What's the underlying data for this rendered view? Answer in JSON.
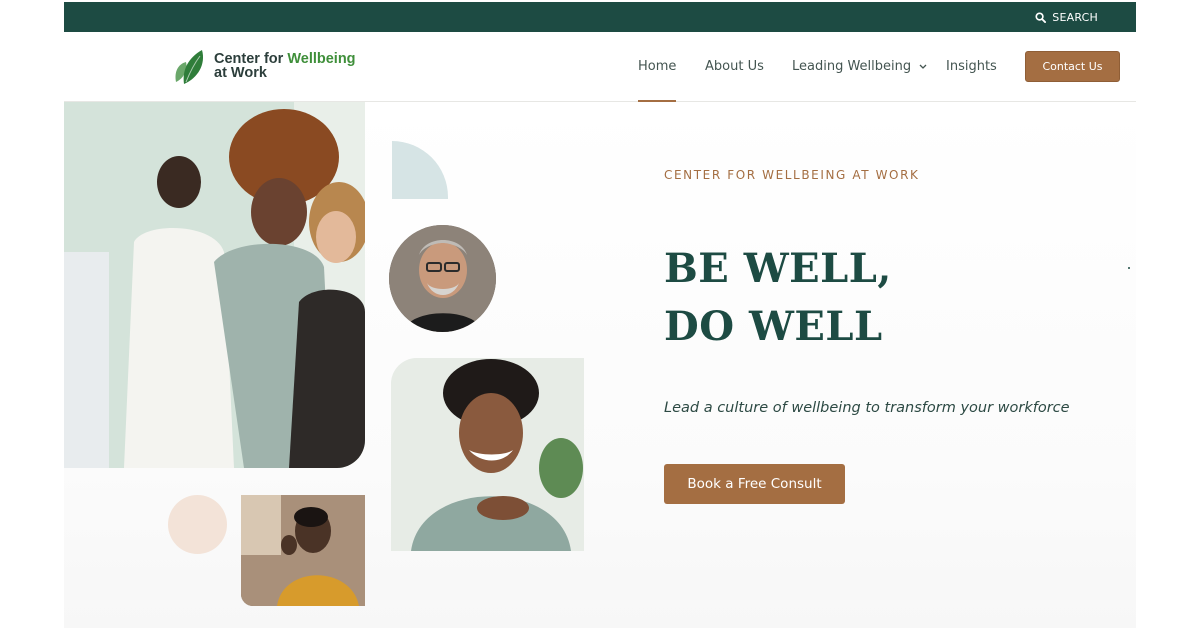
{
  "topbar": {
    "search_label": "SEARCH",
    "search_icon": "search-icon",
    "background_color": "#1d4b43"
  },
  "logo": {
    "line1_prefix": "Center for",
    "line1_accent": "Wellbeing",
    "line2": "at Work",
    "icon": "leaf-icon"
  },
  "nav": {
    "items": [
      {
        "label": "Home",
        "active": true
      },
      {
        "label": "About Us",
        "active": false
      },
      {
        "label": "Leading Wellbeing",
        "active": false,
        "has_dropdown": true
      },
      {
        "label": "Insights",
        "active": false
      }
    ],
    "contact_label": "Contact Us"
  },
  "hero": {
    "eyebrow": "CENTER FOR WELLBEING AT WORK",
    "headline_line1": "BE WELL,",
    "headline_line2": "DO WELL",
    "tagline": "Lead a culture of wellbeing to transform your workforce",
    "cta_label": "Book a Free Consult"
  },
  "colors": {
    "brand_green": "#1d4b43",
    "accent_brown": "#a46e42",
    "leaf_green": "#3f8f3a",
    "deco_blue": "#d6e4e5",
    "deco_peach": "#f3e3d8"
  }
}
